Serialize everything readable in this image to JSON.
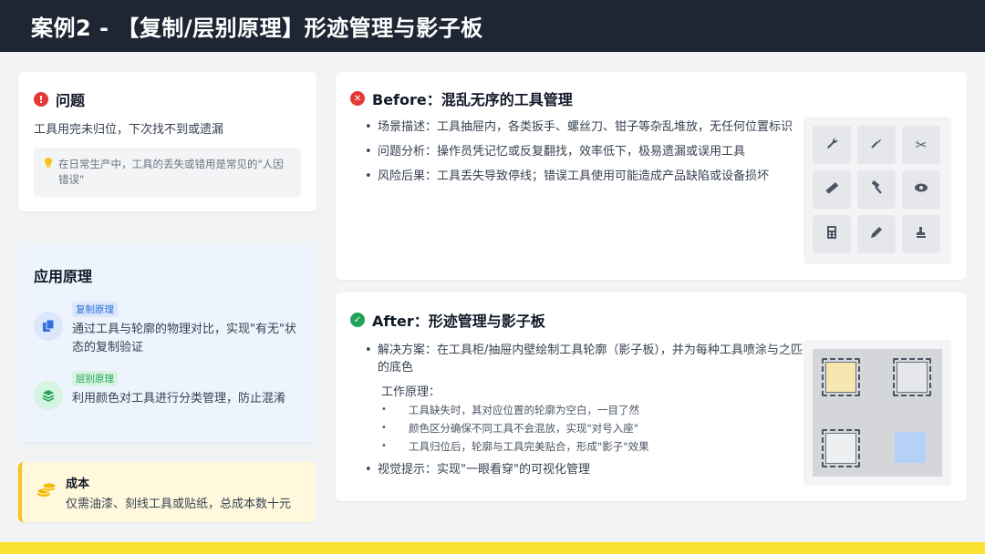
{
  "header": {
    "title": "案例2 - 【复制/层别原理】形迹管理与影子板"
  },
  "problem": {
    "title": "问题",
    "description": "工具用完未归位，下次找不到或遗漏",
    "tip": "在日常生产中，工具的丢失或错用是常见的\"人因错误\""
  },
  "principle": {
    "title": "应用原理",
    "items": [
      {
        "badge": "复制原理",
        "text": "通过工具与轮廓的物理对比，实现\"有无\"状态的复制验证"
      },
      {
        "badge": "层别原理",
        "text": "利用颜色对工具进行分类管理，防止混淆"
      }
    ]
  },
  "cost": {
    "title": "成本",
    "description": "仅需油漆、刻线工具或贴纸，总成本数十元"
  },
  "before": {
    "title": "Before：混乱无序的工具管理",
    "bullets": [
      "场景描述：工具抽屉内，各类扳手、螺丝刀、钳子等杂乱堆放，无任何位置标识",
      "问题分析：操作员凭记忆或反复翻找，效率低下，极易遗漏或误用工具",
      "风险后果：工具丢失导致停线；错误工具使用可能造成产品缺陷或设备损坏"
    ],
    "tools": [
      "wrench-icon",
      "screwdriver-icon",
      "scissors-icon",
      "ruler-icon",
      "hammer-icon",
      "eye-icon",
      "calculator-icon",
      "pencil-icon",
      "stamp-icon"
    ]
  },
  "after": {
    "title": "After：形迹管理与影子板",
    "solution": "解决方案：在工具柜/抽屉内壁绘制工具轮廓（影子板），并为每种工具喷涂与之匹配的底色",
    "work_title": "工作原理：",
    "work_items": [
      "工具缺失时，其对应位置的轮廓为空白，一目了然",
      "颜色区分确保不同工具不会混放，实现\"对号入座\"",
      "工具归位后，轮廓与工具完美贴合，形成\"影子\"效果"
    ],
    "visual": "视觉提示：实现\"一眼看穿\"的可视化管理"
  },
  "colors": {
    "header_bg": "#1e2633",
    "accent_yellow": "#fbe232",
    "error_red": "#e53935",
    "success_green": "#22a559",
    "copy_blue": "#2f6fe0",
    "layer_green": "#22a559"
  }
}
